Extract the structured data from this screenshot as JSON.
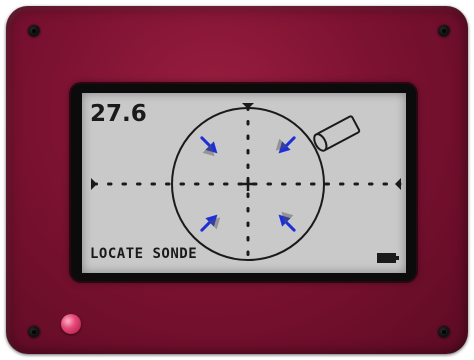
{
  "reading": "27.6",
  "status": "LOCATE SONDE",
  "colors": {
    "case": "#7d1232",
    "lcd": "#c9c9c9",
    "ink": "#1a1a1a",
    "arrow": "#1f2fd8",
    "led": "#e4487a"
  },
  "icons": [
    "sonde-icon",
    "battery-icon",
    "screw-icon",
    "power-led"
  ]
}
